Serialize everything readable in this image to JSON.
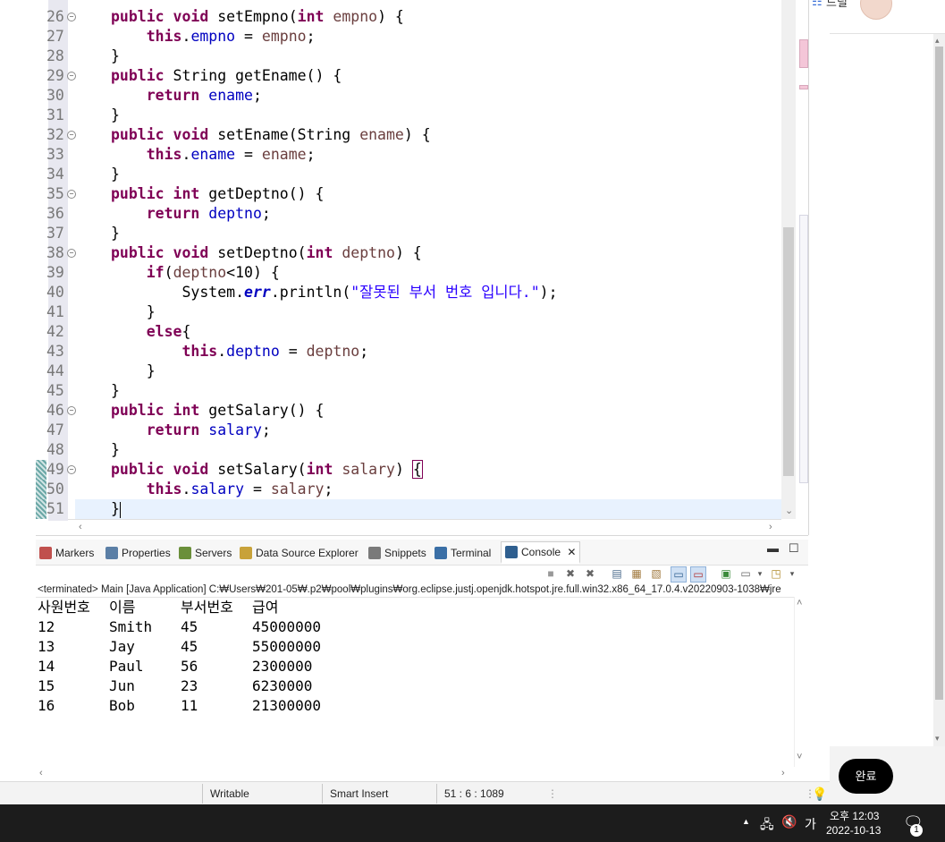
{
  "editor": {
    "lines": [
      {
        "n": "26",
        "fold": true,
        "indent": 1,
        "tokens": [
          [
            "kw",
            "public"
          ],
          [
            "t",
            " "
          ],
          [
            "kw",
            "void"
          ],
          [
            "t",
            " setEmpno("
          ],
          [
            "kw",
            "int"
          ],
          [
            "t",
            " "
          ],
          [
            "prm",
            "empno"
          ],
          [
            "t",
            ") {"
          ]
        ]
      },
      {
        "n": "27",
        "fold": false,
        "indent": 2,
        "tokens": [
          [
            "kw",
            "this"
          ],
          [
            "t",
            "."
          ],
          [
            "fld",
            "empno"
          ],
          [
            "t",
            " = "
          ],
          [
            "prm",
            "empno"
          ],
          [
            "t",
            ";"
          ]
        ]
      },
      {
        "n": "28",
        "fold": false,
        "indent": 1,
        "tokens": [
          [
            "t",
            "}"
          ]
        ]
      },
      {
        "n": "29",
        "fold": true,
        "indent": 1,
        "tokens": [
          [
            "kw",
            "public"
          ],
          [
            "t",
            " String getEname() {"
          ]
        ]
      },
      {
        "n": "30",
        "fold": false,
        "indent": 2,
        "tokens": [
          [
            "kw",
            "return"
          ],
          [
            "t",
            " "
          ],
          [
            "fld",
            "ename"
          ],
          [
            "t",
            ";"
          ]
        ]
      },
      {
        "n": "31",
        "fold": false,
        "indent": 1,
        "tokens": [
          [
            "t",
            "}"
          ]
        ]
      },
      {
        "n": "32",
        "fold": true,
        "indent": 1,
        "tokens": [
          [
            "kw",
            "public"
          ],
          [
            "t",
            " "
          ],
          [
            "kw",
            "void"
          ],
          [
            "t",
            " setEname(String "
          ],
          [
            "prm",
            "ename"
          ],
          [
            "t",
            ") {"
          ]
        ]
      },
      {
        "n": "33",
        "fold": false,
        "indent": 2,
        "tokens": [
          [
            "kw",
            "this"
          ],
          [
            "t",
            "."
          ],
          [
            "fld",
            "ename"
          ],
          [
            "t",
            " = "
          ],
          [
            "prm",
            "ename"
          ],
          [
            "t",
            ";"
          ]
        ]
      },
      {
        "n": "34",
        "fold": false,
        "indent": 1,
        "tokens": [
          [
            "t",
            "}"
          ]
        ]
      },
      {
        "n": "35",
        "fold": true,
        "indent": 1,
        "tokens": [
          [
            "kw",
            "public"
          ],
          [
            "t",
            " "
          ],
          [
            "kw",
            "int"
          ],
          [
            "t",
            " getDeptno() {"
          ]
        ]
      },
      {
        "n": "36",
        "fold": false,
        "indent": 2,
        "tokens": [
          [
            "kw",
            "return"
          ],
          [
            "t",
            " "
          ],
          [
            "fld",
            "deptno"
          ],
          [
            "t",
            ";"
          ]
        ]
      },
      {
        "n": "37",
        "fold": false,
        "indent": 1,
        "tokens": [
          [
            "t",
            "}"
          ]
        ]
      },
      {
        "n": "38",
        "fold": true,
        "indent": 1,
        "tokens": [
          [
            "kw",
            "public"
          ],
          [
            "t",
            " "
          ],
          [
            "kw",
            "void"
          ],
          [
            "t",
            " setDeptno("
          ],
          [
            "kw",
            "int"
          ],
          [
            "t",
            " "
          ],
          [
            "prm",
            "deptno"
          ],
          [
            "t",
            ") {"
          ]
        ]
      },
      {
        "n": "39",
        "fold": false,
        "indent": 2,
        "tokens": [
          [
            "kw",
            "if"
          ],
          [
            "t",
            "("
          ],
          [
            "prm",
            "deptno"
          ],
          [
            "t",
            "<10) {"
          ]
        ]
      },
      {
        "n": "40",
        "fold": false,
        "indent": 3,
        "tokens": [
          [
            "t",
            "System."
          ],
          [
            "err",
            "err"
          ],
          [
            "t",
            ".println("
          ],
          [
            "str",
            "\"잘못된 부서 번호 입니다.\""
          ],
          [
            "t",
            ");"
          ]
        ]
      },
      {
        "n": "41",
        "fold": false,
        "indent": 2,
        "tokens": [
          [
            "t",
            "}"
          ]
        ]
      },
      {
        "n": "42",
        "fold": false,
        "indent": 2,
        "tokens": [
          [
            "kw",
            "else"
          ],
          [
            "t",
            "{"
          ]
        ]
      },
      {
        "n": "43",
        "fold": false,
        "indent": 3,
        "tokens": [
          [
            "kw",
            "this"
          ],
          [
            "t",
            "."
          ],
          [
            "fld",
            "deptno"
          ],
          [
            "t",
            " = "
          ],
          [
            "prm",
            "deptno"
          ],
          [
            "t",
            ";"
          ]
        ]
      },
      {
        "n": "44",
        "fold": false,
        "indent": 2,
        "tokens": [
          [
            "t",
            "}"
          ]
        ]
      },
      {
        "n": "45",
        "fold": false,
        "indent": 1,
        "tokens": [
          [
            "t",
            "}"
          ]
        ]
      },
      {
        "n": "46",
        "fold": true,
        "indent": 1,
        "tokens": [
          [
            "kw",
            "public"
          ],
          [
            "t",
            " "
          ],
          [
            "kw",
            "int"
          ],
          [
            "t",
            " getSalary() {"
          ]
        ]
      },
      {
        "n": "47",
        "fold": false,
        "indent": 2,
        "tokens": [
          [
            "kw",
            "return"
          ],
          [
            "t",
            " "
          ],
          [
            "fld",
            "salary"
          ],
          [
            "t",
            ";"
          ]
        ]
      },
      {
        "n": "48",
        "fold": false,
        "indent": 1,
        "tokens": [
          [
            "t",
            "}"
          ]
        ]
      },
      {
        "n": "49",
        "fold": true,
        "indent": 1,
        "tokens": [
          [
            "kw",
            "public"
          ],
          [
            "t",
            " "
          ],
          [
            "kw",
            "void"
          ],
          [
            "t",
            " setSalary("
          ],
          [
            "kw",
            "int"
          ],
          [
            "t",
            " "
          ],
          [
            "prm",
            "salary"
          ],
          [
            "t",
            ") "
          ],
          [
            "box",
            "{"
          ]
        ]
      },
      {
        "n": "50",
        "fold": false,
        "indent": 2,
        "tokens": [
          [
            "kw",
            "this"
          ],
          [
            "t",
            "."
          ],
          [
            "fld",
            "salary"
          ],
          [
            "t",
            " = "
          ],
          [
            "prm",
            "salary"
          ],
          [
            "t",
            ";"
          ]
        ]
      },
      {
        "n": "51",
        "fold": false,
        "indent": 1,
        "current": true,
        "tokens": [
          [
            "t",
            "}"
          ],
          [
            "caret",
            ""
          ]
        ]
      }
    ]
  },
  "panel": {
    "tabs": [
      {
        "label": "Markers",
        "icon": "markers-icon",
        "color": "#c0504d"
      },
      {
        "label": "Properties",
        "icon": "properties-icon",
        "color": "#5b7fa6"
      },
      {
        "label": "Servers",
        "icon": "servers-icon",
        "color": "#6a8f3a"
      },
      {
        "label": "Data Source Explorer",
        "icon": "data-source-explorer-icon",
        "color": "#c8a23a"
      },
      {
        "label": "Snippets",
        "icon": "snippets-icon",
        "color": "#7a7a7a"
      },
      {
        "label": "Terminal",
        "icon": "terminal-icon",
        "color": "#3a6fa6"
      },
      {
        "label": "Console",
        "icon": "console-icon",
        "color": "#2f5f8f",
        "active": true
      }
    ],
    "terminated_text": "<terminated> Main [Java Application] C:₩Users₩201-05₩.p2₩pool₩plugins₩org.eclipse.justj.openjdk.hotspot.jre.full.win32.x86_64_17.0.4.v20220903-1038₩jre",
    "console": {
      "header": [
        "사원번호",
        "이름",
        "부서번호",
        "급여"
      ],
      "rows": [
        [
          "12",
          "Smith",
          "45",
          "45000000"
        ],
        [
          "13",
          "Jay",
          "45",
          "55000000"
        ],
        [
          "14",
          "Paul",
          "56",
          "2300000"
        ],
        [
          "15",
          "Jun",
          "23",
          "6230000"
        ],
        [
          "16",
          "Bob",
          "11",
          "21300000"
        ]
      ]
    }
  },
  "statusbar": {
    "writable": "Writable",
    "insert_mode": "Smart Insert",
    "position": "51 : 6 : 1089"
  },
  "right_panel": {
    "top_label": "드릴",
    "done_label": "완료"
  },
  "taskbar": {
    "ime": "가",
    "time": "오후 12:03",
    "date": "2022-10-13",
    "notification_count": "1"
  }
}
